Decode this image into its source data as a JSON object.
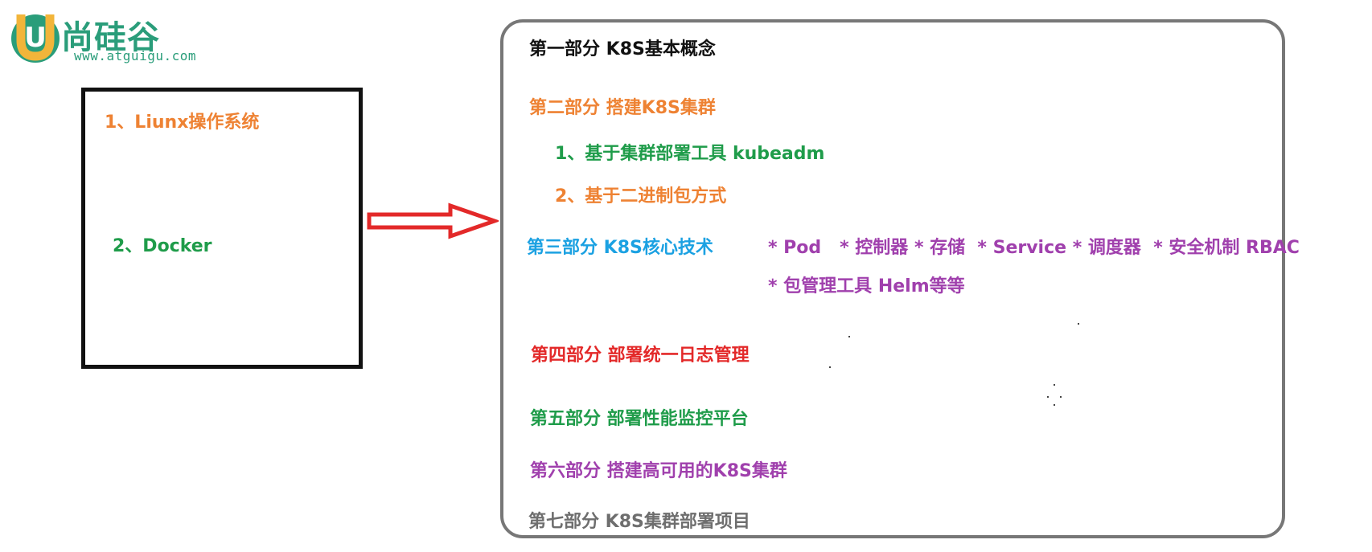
{
  "logo": {
    "letter": "U",
    "name": "尚硅谷",
    "url": "www.atguigu.com"
  },
  "left": {
    "item1": "1、Liunx操作系统",
    "item2": "2、Docker"
  },
  "right": {
    "part1": "第一部分 K8S基本概念",
    "part2": "第二部分 搭建K8S集群",
    "part2_sub1": "1、基于集群部署工具 kubeadm",
    "part2_sub2": "2、基于二进制包方式",
    "part3": "第三部分 K8S核心技术",
    "part3_topics_line1": "* Pod   * 控制器 * 存储  * Service * 调度器  * 安全机制 RBAC",
    "part3_topics_line2": "* 包管理工具 Helm等等",
    "part4": "第四部分 部署统一日志管理",
    "part5": "第五部分 部署性能监控平台",
    "part6": "第六部分 搭建高可用的K8S集群",
    "part7": "第七部分 K8S集群部署项目"
  },
  "colors": {
    "orange": "#ee8233",
    "green": "#1f9c4a",
    "blue": "#1ba1e2",
    "red": "#e32929",
    "purple": "#a040ad",
    "gray": "#6e6e6e",
    "arrow": "#e32929",
    "logo": "#2a9d7a"
  }
}
